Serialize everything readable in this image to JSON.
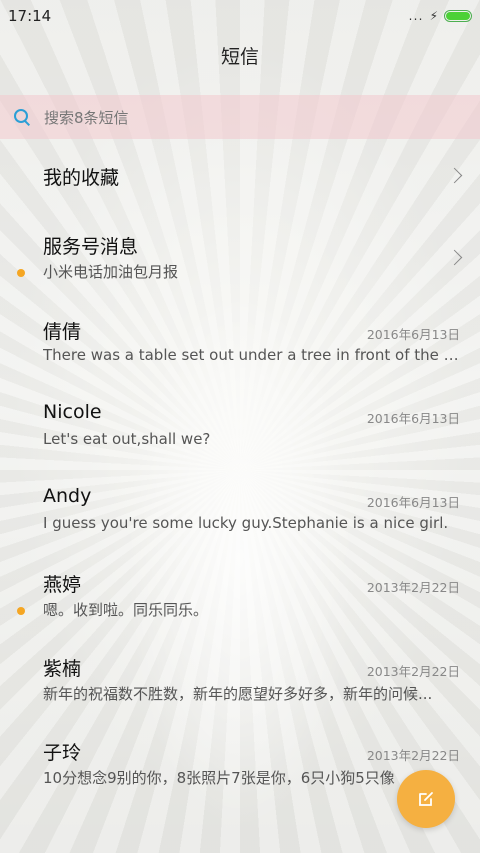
{
  "status_bar": {
    "time": "17:14",
    "signal_dots": "․․․",
    "charging_icon": "⚡"
  },
  "header": {
    "title": "短信"
  },
  "search": {
    "placeholder": "搜索8条短信"
  },
  "conversations": [
    {
      "name": "我的收藏",
      "preview": "",
      "date": "",
      "unread": false,
      "chevron": true
    },
    {
      "name": "服务号消息",
      "preview": "小米电话加油包月报",
      "date": "",
      "unread": true,
      "chevron": true
    },
    {
      "name": "倩倩",
      "preview": "There was a table set out under a tree in front of the ho...",
      "date": "2016年6月13日",
      "unread": false,
      "chevron": false
    },
    {
      "name": "Nicole",
      "preview": "Let's eat out,shall we?",
      "date": "2016年6月13日",
      "unread": false,
      "chevron": false
    },
    {
      "name": "Andy",
      "preview": "I guess you're some lucky guy.Stephanie is a nice girl.",
      "date": "2016年6月13日",
      "unread": false,
      "chevron": false
    },
    {
      "name": "燕婷",
      "preview": "嗯。收到啦。同乐同乐。",
      "date": "2013年2月22日",
      "unread": true,
      "chevron": false
    },
    {
      "name": "紫楠",
      "preview": "新年的祝福数不胜数，新年的愿望好多好多，新年的问候...",
      "date": "2013年2月22日",
      "unread": false,
      "chevron": false
    },
    {
      "name": "子玲",
      "preview": "10分想念9别的你，8张照片7张是你，6只小狗5只像",
      "date": "2013年2月22日",
      "unread": false,
      "chevron": false
    }
  ],
  "colors": {
    "accent": "#f5b041",
    "unread_dot": "#f5a623",
    "search_icon": "#2a9fd6",
    "battery": "#4cd137"
  },
  "battery_level": 1.0,
  "icons": {
    "fab": "compose-icon",
    "search": "search-icon",
    "chevron": "chevron-right-icon"
  }
}
